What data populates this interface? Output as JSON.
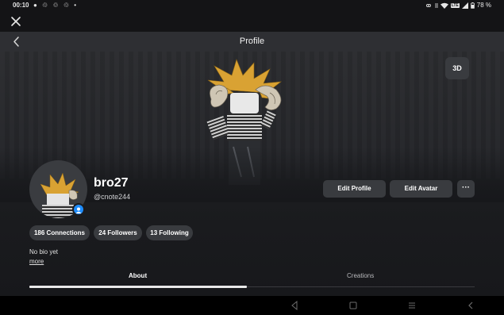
{
  "status_bar": {
    "time": "00:10",
    "notification_icons": [
      "chat-icon",
      "sync-icon",
      "sync-icon",
      "sync-icon",
      "dot-icon"
    ],
    "notification_glyphs": "● ♲ ♲ ♲ •",
    "lte_label": "LTE",
    "battery": "78 %"
  },
  "window": {
    "close_icon": "close-icon"
  },
  "nav": {
    "title": "Profile",
    "back_icon": "chevron-left-icon"
  },
  "hero": {
    "view_3d_label": "3D"
  },
  "profile": {
    "display_name": "bro27",
    "username": "@cnote244",
    "online_status_color": "#1e8dff",
    "bio": "No bio yet",
    "more_label": "more"
  },
  "actions": {
    "edit_profile": "Edit Profile",
    "edit_avatar": "Edit Avatar",
    "more_options": "···"
  },
  "stats": {
    "connections": "186 Connections",
    "followers": "24 Followers",
    "following": "13 Following"
  },
  "tabs": [
    {
      "label": "About",
      "selected": true
    },
    {
      "label": "Creations",
      "selected": false
    }
  ],
  "android_nav": {
    "back_icon": "triangle-back-icon",
    "home_icon": "square-home-icon",
    "menu_icon": "menu-lines-icon",
    "collapse_icon": "chevron-left-icon"
  },
  "colors": {
    "background": "#17181b",
    "surface": "#393b3f",
    "nav_bar": "#2e2f33",
    "accent_blue": "#1e8dff"
  }
}
